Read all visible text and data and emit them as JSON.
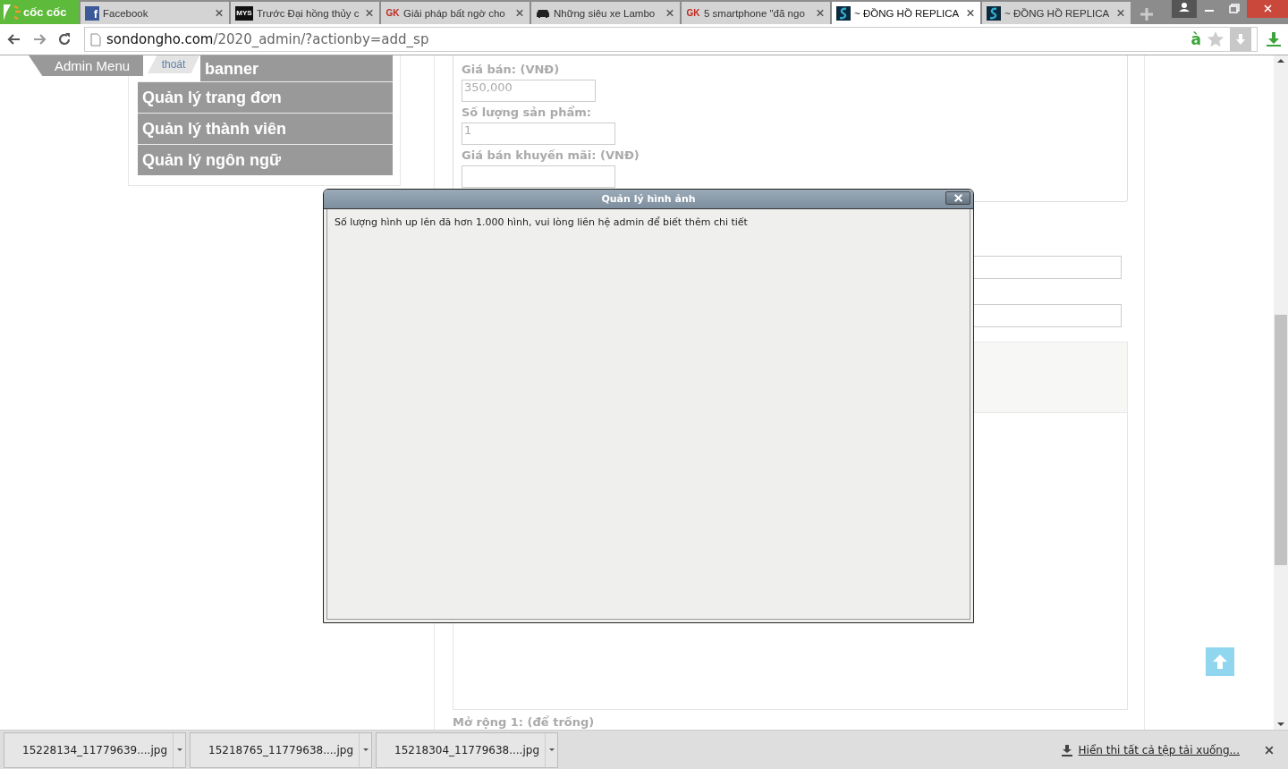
{
  "browser": {
    "logo_text": "cốc cốc",
    "tabs": [
      {
        "title": "Facebook",
        "favicon": {
          "kind": "facebook",
          "text": "f"
        },
        "selected": false
      },
      {
        "title": "Trước Đại hồng thủy c",
        "favicon": {
          "kind": "badge",
          "text": "MYS"
        },
        "selected": false
      },
      {
        "title": "Giải pháp bất ngờ cho",
        "favicon": {
          "kind": "letters",
          "text": "GK"
        },
        "selected": false
      },
      {
        "title": "Những siêu xe Lambo",
        "favicon": {
          "kind": "car"
        },
        "selected": false
      },
      {
        "title": "5 smartphone \"đã ngo",
        "favicon": {
          "kind": "letters",
          "text": "GK"
        },
        "selected": false
      },
      {
        "title": "~ ĐỒNG HỒ REPLICA",
        "favicon": {
          "kind": "site"
        },
        "selected": true
      },
      {
        "title": "~ ĐỒNG HỒ REPLICA",
        "favicon": {
          "kind": "site"
        },
        "selected": false
      }
    ],
    "address": {
      "host": "sondongho.com",
      "path": "/2020_admin/?actionby=add_sp"
    },
    "dictionary_glyph": "à"
  },
  "admin_menu": {
    "tab_label": "Admin Menu",
    "logout_label": "thoát",
    "items": [
      "banner",
      "Quản lý trang đơn",
      "Quản lý thành viên",
      "Quản lý ngôn ngữ"
    ]
  },
  "form": {
    "fields": [
      {
        "label": "Giá bán: (VNĐ)",
        "value": "350,000"
      },
      {
        "label": "Số lượng sản phẩm:",
        "value": "1"
      },
      {
        "label": "Giá bán khuyến mãi: (VNĐ)"
      }
    ],
    "next_label": "Mở rộng 1: (để trống)"
  },
  "dialog": {
    "title": "Quản lý hình ảnh",
    "message": "Số lượng hình up lên đã hơn 1.000 hình, vui lòng liên hệ admin để biết thêm chi tiết"
  },
  "downloads": {
    "items": [
      "15228134_11779639....jpg",
      "15218765_11779638....jpg",
      "15218304_11779638....jpg"
    ],
    "show_all": "Hiển thi tất cả tệp tải xuống..."
  }
}
